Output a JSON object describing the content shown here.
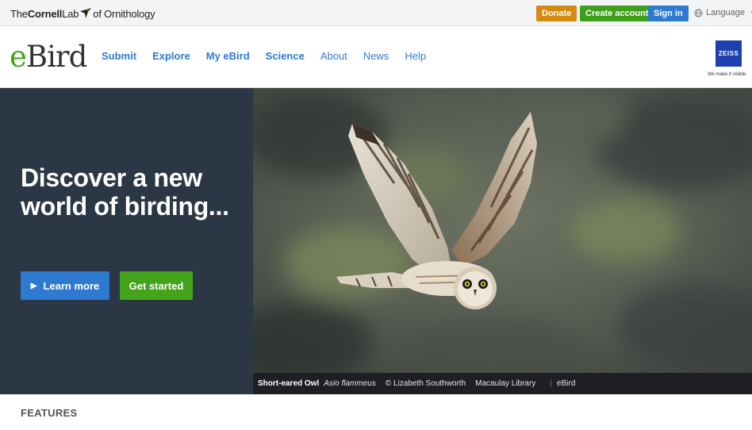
{
  "topbar": {
    "logo_the": "The",
    "logo_cornell": "Cornell",
    "logo_lab": "Lab",
    "logo_of": "of Ornithology",
    "donate": "Donate",
    "create_account": "Create account",
    "sign_in": "Sign in",
    "language": "Language",
    "colors": {
      "donate": "#d48a11",
      "create": "#3ea01a",
      "signin": "#2f7ad1"
    }
  },
  "header": {
    "logo_e": "e",
    "logo_bird": "Bird",
    "nav": [
      {
        "label": "Submit"
      },
      {
        "label": "Explore"
      },
      {
        "label": "My eBird"
      },
      {
        "label": "Science"
      },
      {
        "label": "About"
      },
      {
        "label": "News"
      },
      {
        "label": "Help"
      }
    ],
    "sponsor_name": "ZEISS",
    "sponsor_tagline": "We make it visible."
  },
  "hero": {
    "title": "Discover a new world of birding...",
    "learn_more": "Learn more",
    "get_started": "Get started",
    "caption": {
      "common_name": "Short-eared Owl",
      "scientific_name": "Asio flammeus",
      "credit": "© Lizabeth Southworth",
      "library": "Macaulay Library",
      "source": "eBird"
    }
  },
  "sections": {
    "features": "FEATURES"
  }
}
